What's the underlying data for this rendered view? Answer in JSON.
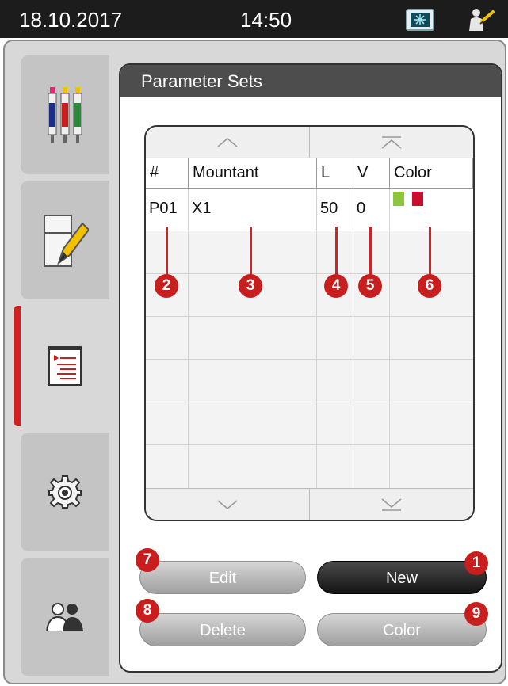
{
  "status_bar": {
    "date": "18.10.2017",
    "time": "14:50",
    "screen_icon": "snowflake-screen-icon",
    "user_icon": "user-supervisor-icon"
  },
  "nav": {
    "items": [
      {
        "id": "reagents",
        "icon": "reagent-bottles-icon"
      },
      {
        "id": "notes",
        "icon": "pencil-note-icon"
      },
      {
        "id": "parameter-sets",
        "icon": "parameter-list-icon",
        "active": true
      },
      {
        "id": "settings",
        "icon": "gear-icon"
      },
      {
        "id": "user",
        "icon": "user-group-icon"
      }
    ],
    "active_color": "#d42020"
  },
  "panel": {
    "title": "Parameter Sets"
  },
  "table": {
    "columns": [
      "#",
      "Mountant",
      "L",
      "V",
      "Color"
    ],
    "rows": [
      {
        "id": "P01",
        "mountant": "X1",
        "l": "50",
        "v": "0",
        "colors": [
          "#8cc63f",
          "#c8102e"
        ]
      }
    ],
    "empty_rows": 6
  },
  "callouts": [
    "1",
    "2",
    "3",
    "4",
    "5",
    "6",
    "7",
    "8",
    "9"
  ],
  "buttons": {
    "edit": "Edit",
    "new": "New",
    "delete": "Delete",
    "color": "Color"
  }
}
